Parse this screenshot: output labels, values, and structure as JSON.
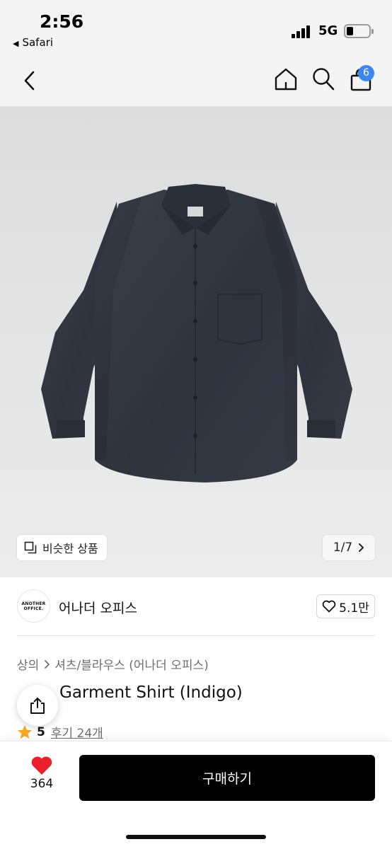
{
  "status_bar": {
    "time": "2:56",
    "back_app": "Safari",
    "network": "5G"
  },
  "navbar": {
    "back_icon": "chevron-left-icon",
    "home_icon": "home-icon",
    "search_icon": "search-icon",
    "cart_icon": "shopping-bag-icon",
    "cart_count": "6"
  },
  "gallery": {
    "similar_label": "비슷한 상품",
    "pager": "1/7"
  },
  "brand": {
    "logo_line1": "ANOTHER",
    "logo_line2": "OFFICE.",
    "name": "어나더 오피스",
    "likes": "5.1만"
  },
  "product": {
    "breadcrumb": [
      "상의",
      "셔츠/블라우스 (어나더 오피스)"
    ],
    "title": "Garment Shirt (Indigo)",
    "rating": "5",
    "reviews": "후기 24개"
  },
  "bottom": {
    "wish_count": "364",
    "buy_label": "구매하기"
  },
  "colors": {
    "accent_badge": "#3b86f0",
    "heart": "#e8212c",
    "star": "#f5a623",
    "buy_button": "#000000"
  }
}
